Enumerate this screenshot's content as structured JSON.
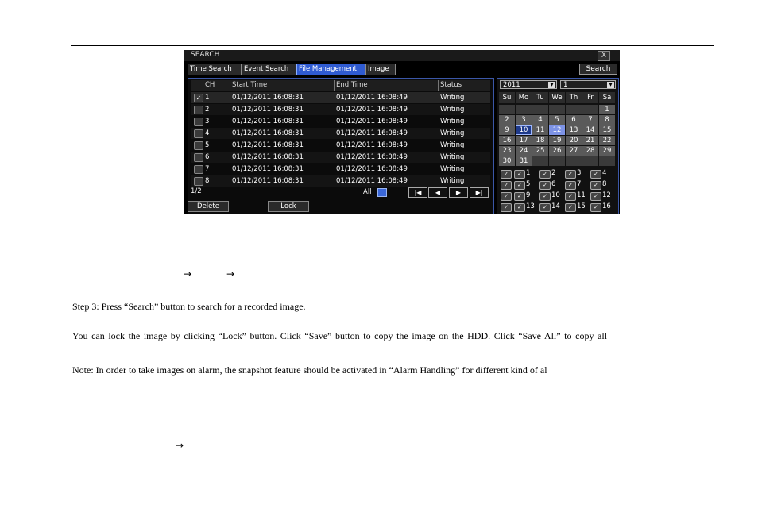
{
  "window": {
    "title": "SEARCH",
    "close": "X",
    "tabs": [
      "Time Search",
      "Event Search",
      "File Management",
      "Image"
    ],
    "search_button": "Search"
  },
  "table": {
    "columns": [
      "CH",
      "Start Time",
      "End Time",
      "Status"
    ],
    "rows": [
      {
        "ch": "1",
        "start": "01/12/2011 16:08:31",
        "end": "01/12/2011 16:08:49",
        "status": "Writing",
        "checked": true
      },
      {
        "ch": "2",
        "start": "01/12/2011 16:08:31",
        "end": "01/12/2011 16:08:49",
        "status": "Writing",
        "checked": false
      },
      {
        "ch": "3",
        "start": "01/12/2011 16:08:31",
        "end": "01/12/2011 16:08:49",
        "status": "Writing",
        "checked": false
      },
      {
        "ch": "4",
        "start": "01/12/2011 16:08:31",
        "end": "01/12/2011 16:08:49",
        "status": "Writing",
        "checked": false
      },
      {
        "ch": "5",
        "start": "01/12/2011 16:08:31",
        "end": "01/12/2011 16:08:49",
        "status": "Writing",
        "checked": false
      },
      {
        "ch": "6",
        "start": "01/12/2011 16:08:31",
        "end": "01/12/2011 16:08:49",
        "status": "Writing",
        "checked": false
      },
      {
        "ch": "7",
        "start": "01/12/2011 16:08:31",
        "end": "01/12/2011 16:08:49",
        "status": "Writing",
        "checked": false
      },
      {
        "ch": "8",
        "start": "01/12/2011 16:08:31",
        "end": "01/12/2011 16:08:49",
        "status": "Writing",
        "checked": false
      }
    ],
    "page": "1/2",
    "all_label": "All",
    "nav": [
      "|◀",
      "◀",
      "▶",
      "▶|"
    ],
    "delete_button": "Delete",
    "lock_button": "Lock"
  },
  "calendar": {
    "year": "2011",
    "month": "1",
    "weekdays": [
      "Su",
      "Mo",
      "Tu",
      "We",
      "Th",
      "Fr",
      "Sa"
    ],
    "weeks": [
      [
        "",
        "",
        "",
        "",
        "",
        "",
        "1"
      ],
      [
        "2",
        "3",
        "4",
        "5",
        "6",
        "7",
        "8"
      ],
      [
        "9",
        "10",
        "11",
        "12",
        "13",
        "14",
        "15"
      ],
      [
        "16",
        "17",
        "18",
        "19",
        "20",
        "21",
        "22"
      ],
      [
        "23",
        "24",
        "25",
        "26",
        "27",
        "28",
        "29"
      ],
      [
        "30",
        "31",
        "",
        "",
        "",
        "",
        ""
      ]
    ],
    "highlight_day": "10",
    "today_day": "12",
    "channels": [
      "1",
      "2",
      "3",
      "4",
      "5",
      "6",
      "7",
      "8",
      "9",
      "10",
      "11",
      "12",
      "13",
      "14",
      "15",
      "16"
    ]
  },
  "doc": {
    "arrow": "→",
    "step3": "Step 3: Press “Search” button to search for a recorded image.",
    "lock_para": "You can lock the image by clicking “Lock” button. Click “Save” button to copy the image on the HDD. Click “Save All” to copy all",
    "note": "Note: In order to take images on alarm, the snapshot feature should be activated in “Alarm Handling” for different kind of al"
  }
}
